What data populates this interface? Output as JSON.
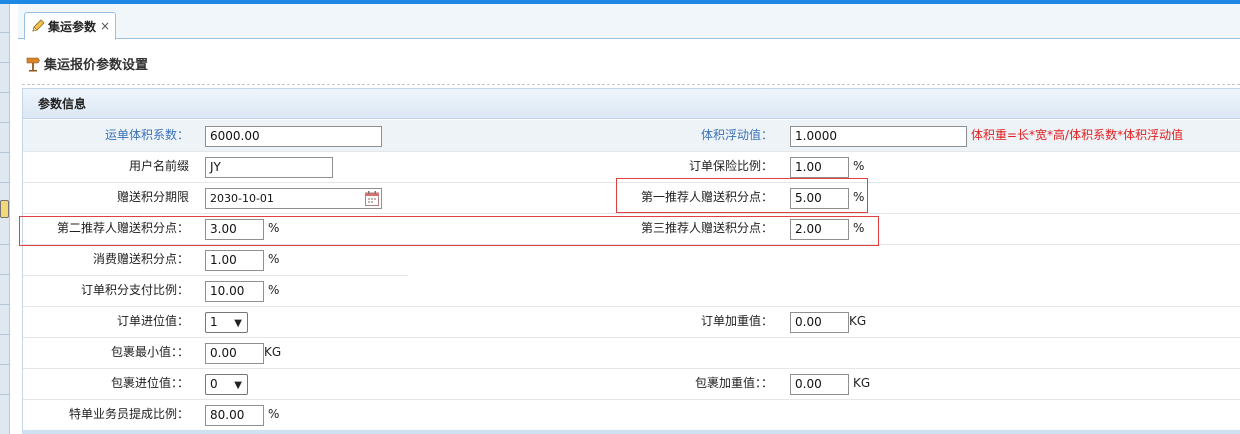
{
  "tab": {
    "label": "集运参数",
    "close": "×"
  },
  "page": {
    "title": "集运报价参数设置"
  },
  "panel": {
    "header": "参数信息"
  },
  "fields": {
    "volume_coef": {
      "label": "运单体积系数：",
      "value": "6000.00"
    },
    "volume_float": {
      "label": "体积浮动值：",
      "value": "1.0000",
      "note": "体积重=长*宽*高/体积系数*体积浮动值"
    },
    "user_prefix": {
      "label": "用户名前缀",
      "value": "JY"
    },
    "insurance_ratio": {
      "label": "订单保险比例：",
      "value": "1.00",
      "unit": "%"
    },
    "gift_points_expiry": {
      "label": "赠送积分期限",
      "value": "2030-10-01"
    },
    "referrer1_points": {
      "label": "第一推荐人赠送积分点：",
      "value": "5.00",
      "unit": "%"
    },
    "referrer2_points": {
      "label": "第二推荐人赠送积分点：",
      "value": "3.00",
      "unit": "%"
    },
    "referrer3_points": {
      "label": "第三推荐人赠送积分点：",
      "value": "2.00",
      "unit": "%"
    },
    "consume_points": {
      "label": "消费赠送积分点：",
      "value": "1.00",
      "unit": "%"
    },
    "order_points_ratio": {
      "label": "订单积分支付比例：",
      "value": "10.00",
      "unit": "%"
    },
    "order_rounding": {
      "label": "订单进位值：",
      "value": "1"
    },
    "order_increment": {
      "label": "订单加重值：",
      "value": "0.00",
      "unit": "KG"
    },
    "package_min": {
      "label": "包裹最小值：：",
      "value": "0.00",
      "unit": "KG"
    },
    "package_rounding": {
      "label": "包裹进位值：：",
      "value": "0"
    },
    "package_increment": {
      "label": "包裹加重值：：",
      "value": "0.00",
      "unit": "KG"
    },
    "staff_commission": {
      "label": "特单业务员提成比例：",
      "value": "80.00",
      "unit": "%"
    }
  },
  "icons": {
    "tab": "pencil-icon",
    "title": "settings-icon",
    "date": "calendar-icon",
    "select": "chevron-down-icon"
  },
  "colors": {
    "accent": "#1e88e5",
    "label_blue": "#3a72b8",
    "note_red": "#e02020",
    "highlight_border": "#e04040"
  }
}
